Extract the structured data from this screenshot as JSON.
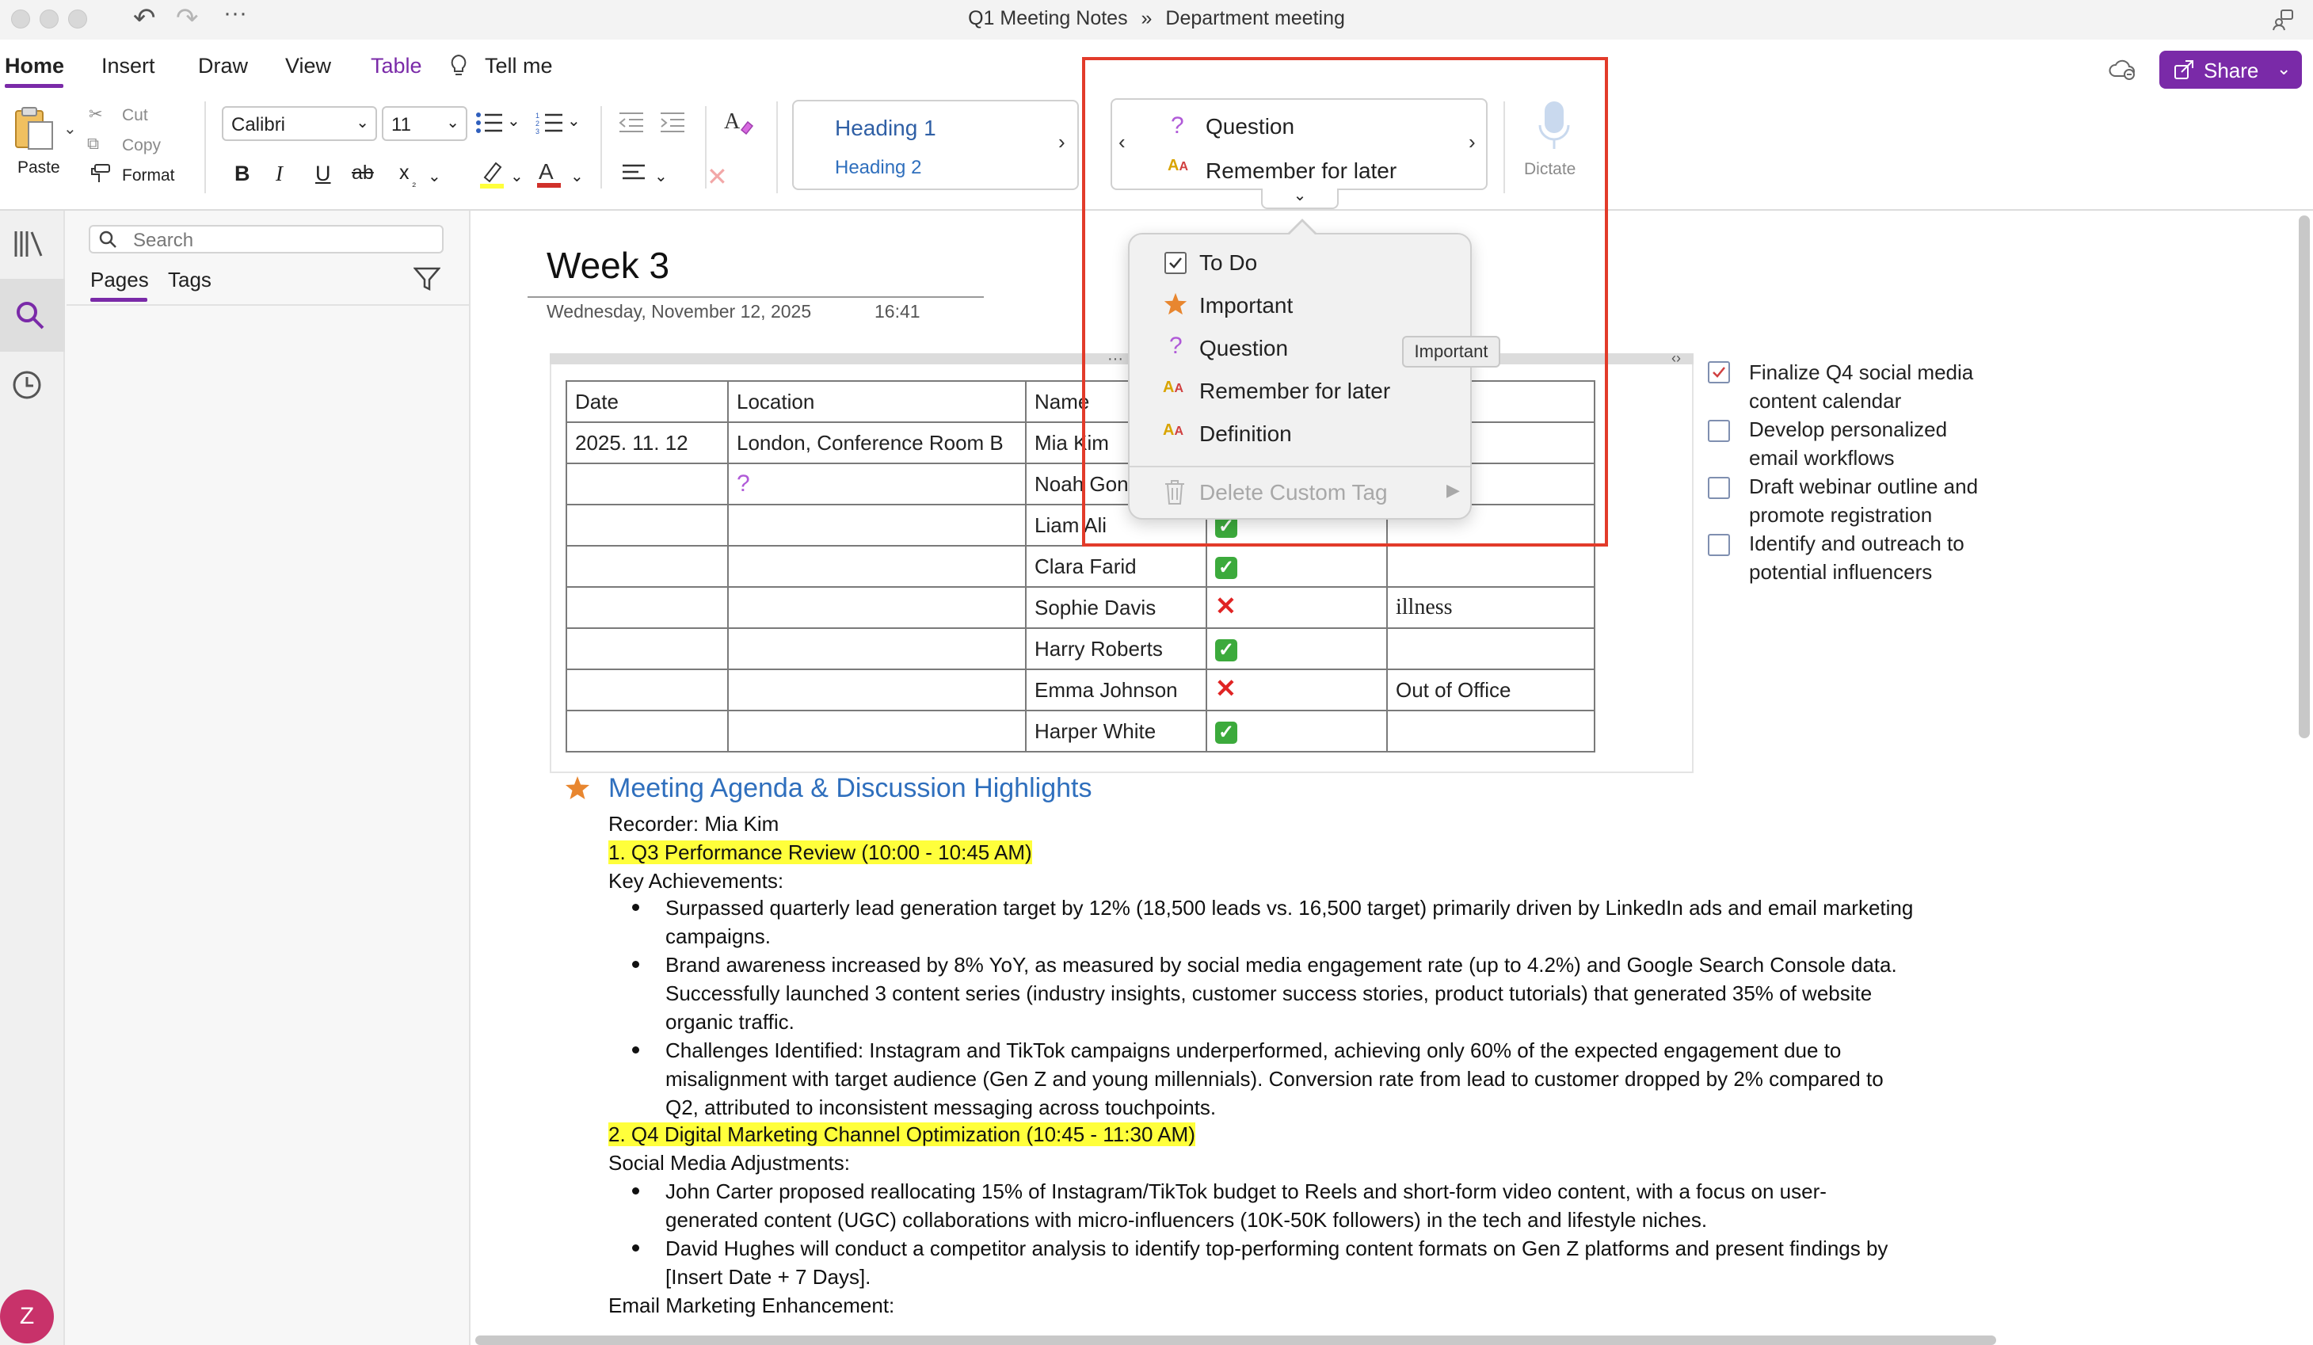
{
  "titlebar": {
    "crumb_notebook": "Q1 Meeting Notes",
    "crumb_sep": "»",
    "crumb_section": "Department meeting"
  },
  "menu": {
    "tabs": [
      "Home",
      "Insert",
      "Draw",
      "View",
      "Table"
    ],
    "tell_me": "Tell me",
    "share": "Share"
  },
  "ribbon": {
    "paste": "Paste",
    "cut": "Cut",
    "copy": "Copy",
    "format": "Format",
    "font_name": "Calibri",
    "font_size": "11",
    "styles": {
      "heading1": "Heading 1",
      "heading2": "Heading 2"
    },
    "tags": {
      "tag1": "Question",
      "tag2": "Remember for later"
    },
    "dictate": "Dictate",
    "bold": "B",
    "italic": "I",
    "underline": "U",
    "strike": "ab",
    "subscript": "x"
  },
  "sidebar": {
    "search_placeholder": "Search",
    "tabs": [
      "Pages",
      "Tags"
    ]
  },
  "user": {
    "avatar_initial": "Z"
  },
  "page": {
    "title": "Week 3",
    "date": "Wednesday, November 12, 2025",
    "time": "16:41"
  },
  "table": {
    "headers": [
      "Date",
      "Location",
      "Name",
      "",
      ""
    ],
    "rows": [
      {
        "date": "2025.  11. 12",
        "location": "London, Conference Room B",
        "name": "Mia Kim",
        "status": "",
        "note": ""
      },
      {
        "date": "",
        "location": "",
        "name": "Noah Gon",
        "status": "",
        "note": ""
      },
      {
        "date": "",
        "location": "",
        "name": "Liam Ali",
        "status": "ok",
        "note": ""
      },
      {
        "date": "",
        "location": "",
        "name": "Clara Farid",
        "status": "ok",
        "note": ""
      },
      {
        "date": "",
        "location": "",
        "name": "Sophie Davis",
        "status": "no",
        "note": "illness"
      },
      {
        "date": "",
        "location": "",
        "name": "Harry Roberts",
        "status": "ok",
        "note": ""
      },
      {
        "date": "",
        "location": "",
        "name": "Emma Johnson",
        "status": "no",
        "note": "Out of  Office"
      },
      {
        "date": "",
        "location": "",
        "name": "Harper  White",
        "status": "ok",
        "note": ""
      }
    ]
  },
  "todos": [
    {
      "line1": "Finalize Q4 social media",
      "line2": "content calendar",
      "checked": true
    },
    {
      "line1": "Develop personalized",
      "line2": "email workflows",
      "checked": false
    },
    {
      "line1": "Draft webinar outline and",
      "line2": "promote registration",
      "checked": false
    },
    {
      "line1": "Identify and outreach to",
      "line2": "potential influencers",
      "checked": false
    }
  ],
  "notes": {
    "heading": "Meeting Agenda & Discussion Highlights",
    "recorder": "Recorder: Mia Kim",
    "section1": "1. Q3 Performance Review (10:00 - 10:45 AM)",
    "key_achievements": "Key Achievements:",
    "b1_l1": "Surpassed quarterly lead generation target by 12% (18,500 leads vs. 16,500 target) primarily driven by LinkedIn ads and email marketing",
    "b1_l2": "campaigns.",
    "b2_l1": "Brand awareness increased by 8% YoY, as measured by social media engagement rate (up to 4.2%) and Google Search Console data.",
    "b2_l2": "Successfully launched 3 content series (industry insights, customer success stories, product tutorials) that generated 35% of website",
    "b2_l3": "organic traffic.",
    "b3_l1": "Challenges Identified: Instagram and TikTok campaigns underperformed, achieving only 60% of the expected engagement due to",
    "b3_l2": "misalignment with target audience (Gen Z and young millennials). Conversion rate from lead to customer dropped by 2% compared to",
    "b3_l3": "Q2, attributed to inconsistent messaging across touchpoints.",
    "section2": "2. Q4 Digital Marketing Channel Optimization (10:45 - 11:30 AM)",
    "social_adj": "Social Media Adjustments:",
    "b4_l1": "John Carter proposed reallocating 15% of Instagram/TikTok budget to Reels and short-form video content, with a focus on user-",
    "b4_l2": "generated content (UGC) collaborations with micro-influencers (10K-50K followers) in the tech and lifestyle niches.",
    "b5_l1": "David Hughes will conduct a competitor analysis to identify top-performing content formats on Gen Z platforms and present findings by",
    "b5_l2": "[Insert Date + 7 Days].",
    "email_enh": "Email Marketing Enhancement:"
  },
  "dropdown": {
    "items": [
      "To Do",
      "Important",
      "Question",
      "Remember for later",
      "Definition"
    ],
    "delete": "Delete Custom Tag",
    "tooltip": "Important"
  },
  "colors": {
    "accent": "#7a2aa8",
    "highlight": "#ffff3b",
    "heading_blue": "#2f6fbd",
    "star": "#e8862f",
    "annotation_red": "#e23b2a"
  }
}
